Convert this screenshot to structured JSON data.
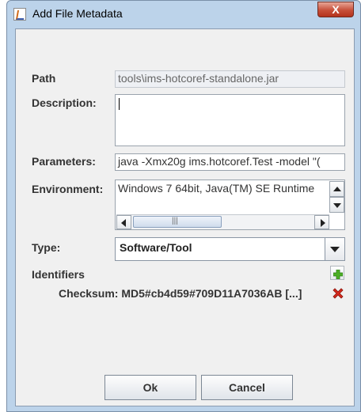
{
  "window": {
    "title": "Add File Metadata",
    "close_label": "X"
  },
  "form": {
    "path_label": "Path",
    "path_value": "tools\\ims-hotcoref-standalone.jar",
    "description_label": "Description:",
    "description_value": "",
    "parameters_label": "Parameters:",
    "parameters_value": "java -Xmx20g ims.hotcoref.Test -model \"(",
    "environment_label": "Environment:",
    "environment_value": "Windows 7 64bit, Java(TM) SE Runtime",
    "scroll_thumb_grip": "|||",
    "type_label": "Type:",
    "type_value": "Software/Tool",
    "identifiers_label": "Identifiers",
    "checksum_text": "Checksum: MD5#cb4d59#709D11A7036AB [...]"
  },
  "buttons": {
    "ok_label": "Ok",
    "cancel_label": "Cancel"
  },
  "icons": {
    "add_identifier": "plus-icon",
    "remove_identifier": "red-x-icon",
    "add_color": "#4caf26",
    "remove_color": "#d62a1e"
  }
}
